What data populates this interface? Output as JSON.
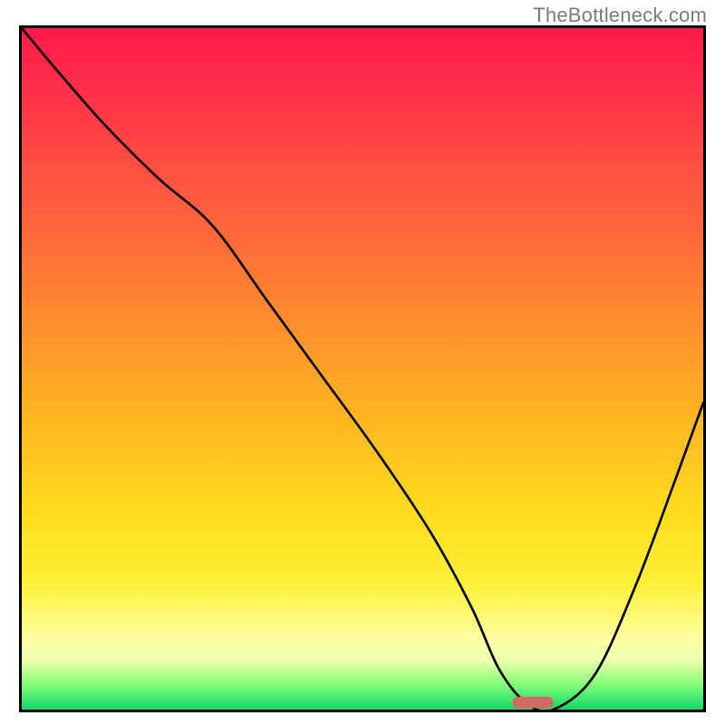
{
  "watermark": "TheBottleneck.com",
  "chart_data": {
    "type": "line",
    "title": "",
    "xlabel": "",
    "ylabel": "",
    "xlim": [
      0,
      100
    ],
    "ylim": [
      0,
      100
    ],
    "grid": false,
    "legend": false,
    "series": [
      {
        "name": "curve",
        "x": [
          0,
          5,
          12,
          20,
          28,
          36,
          44,
          52,
          60,
          66,
          70,
          74,
          78,
          84,
          90,
          96,
          100
        ],
        "y": [
          100,
          94,
          86,
          78,
          71,
          60,
          49,
          38,
          26,
          15,
          6,
          1,
          0,
          5,
          18,
          34,
          45
        ]
      }
    ],
    "marker": {
      "name": "optimal-point",
      "x_range": [
        72,
        78
      ],
      "y": 0
    },
    "background_gradient": {
      "stops": [
        {
          "pos": 0,
          "color": "#ff1a4b"
        },
        {
          "pos": 8,
          "color": "#ff2e4a"
        },
        {
          "pos": 25,
          "color": "#ff5a3f"
        },
        {
          "pos": 42,
          "color": "#ff8a30"
        },
        {
          "pos": 58,
          "color": "#ffb81f"
        },
        {
          "pos": 72,
          "color": "#ffde1e"
        },
        {
          "pos": 82,
          "color": "#fff23a"
        },
        {
          "pos": 90,
          "color": "#ffffa8"
        },
        {
          "pos": 93,
          "color": "#e9ffab"
        },
        {
          "pos": 96,
          "color": "#8cff7a"
        },
        {
          "pos": 100,
          "color": "#12d86a"
        }
      ]
    }
  }
}
